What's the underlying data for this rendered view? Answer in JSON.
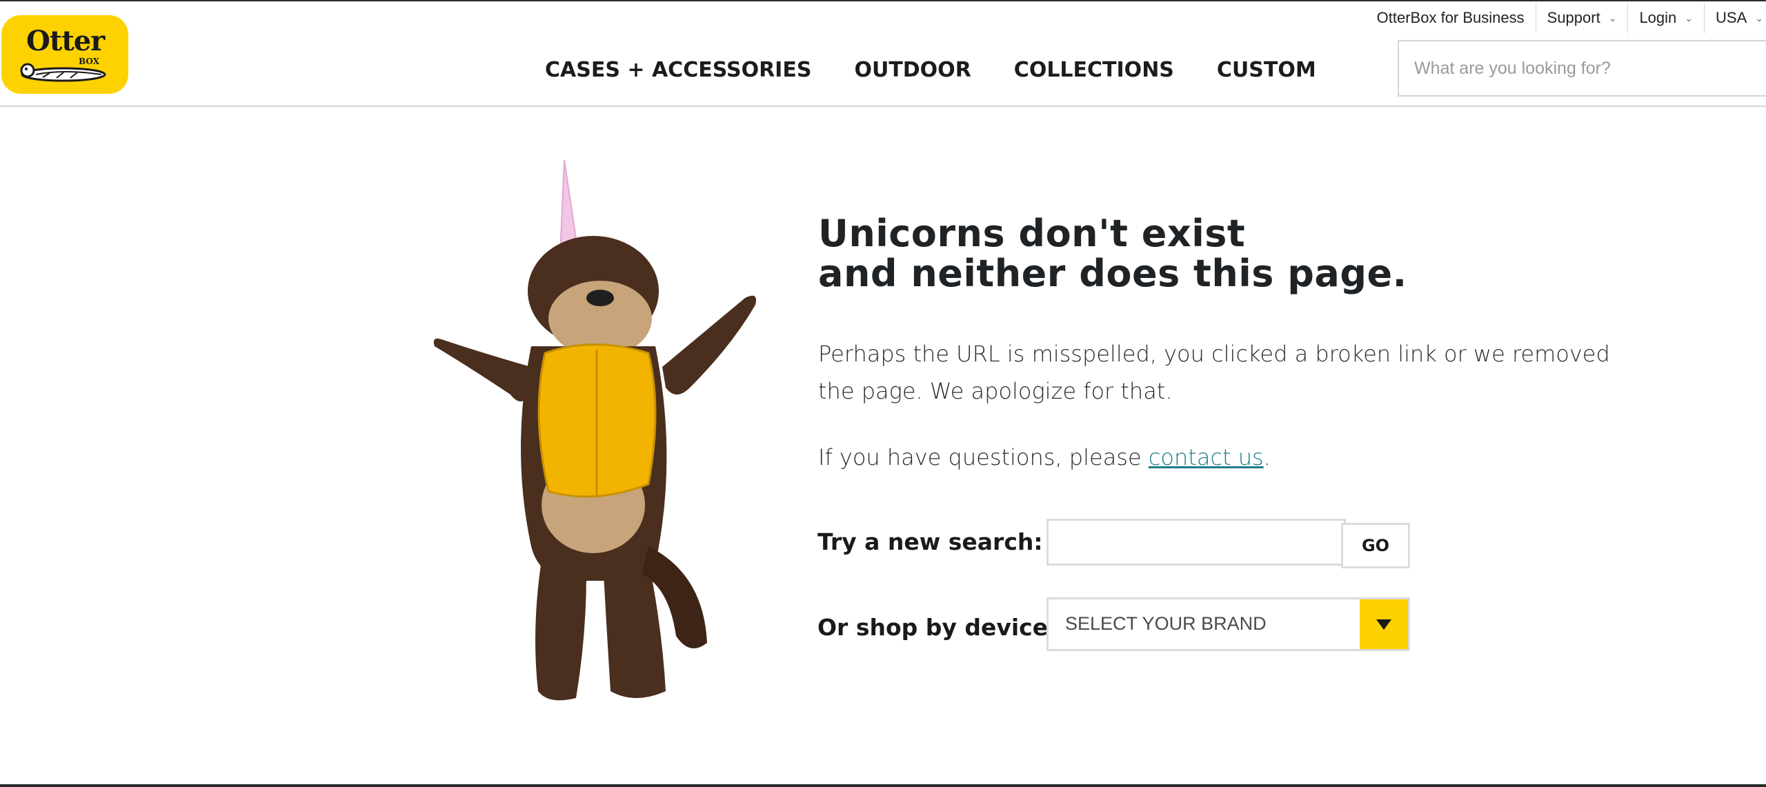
{
  "header": {
    "logo": {
      "word": "Otter",
      "sub": "BOX",
      "icon": "otter-logo-icon"
    },
    "utility": [
      {
        "label": "OtterBox for Business",
        "dropdown": false
      },
      {
        "label": "Support",
        "dropdown": true
      },
      {
        "label": "Login",
        "dropdown": true
      },
      {
        "label": "USA",
        "dropdown": true
      }
    ],
    "nav": [
      "CASES + ACCESSORIES",
      "OUTDOOR",
      "COLLECTIONS",
      "CUSTOM"
    ],
    "search": {
      "placeholder": "What are you looking for?",
      "value": ""
    }
  },
  "error_page": {
    "headline_line1": "Unicorns don't exist",
    "headline_line2": "and neither does this page.",
    "paragraph1": "Perhaps the URL is misspelled, you clicked a broken link or we removed the page. We apologize for that.",
    "paragraph2_before": "If you have questions, please ",
    "paragraph2_link": "contact us",
    "paragraph2_after": ".",
    "search_label": "Try a new search:",
    "search_value": "",
    "go_label": "GO",
    "device_label": "Or shop by device:",
    "brand_select": "SELECT YOUR BRAND",
    "mascot": "otter-mascot-with-unicorn-horn"
  },
  "colors": {
    "brand_yellow": "#fdd200",
    "link": "#1a7c8a",
    "text": "#1f2326"
  }
}
